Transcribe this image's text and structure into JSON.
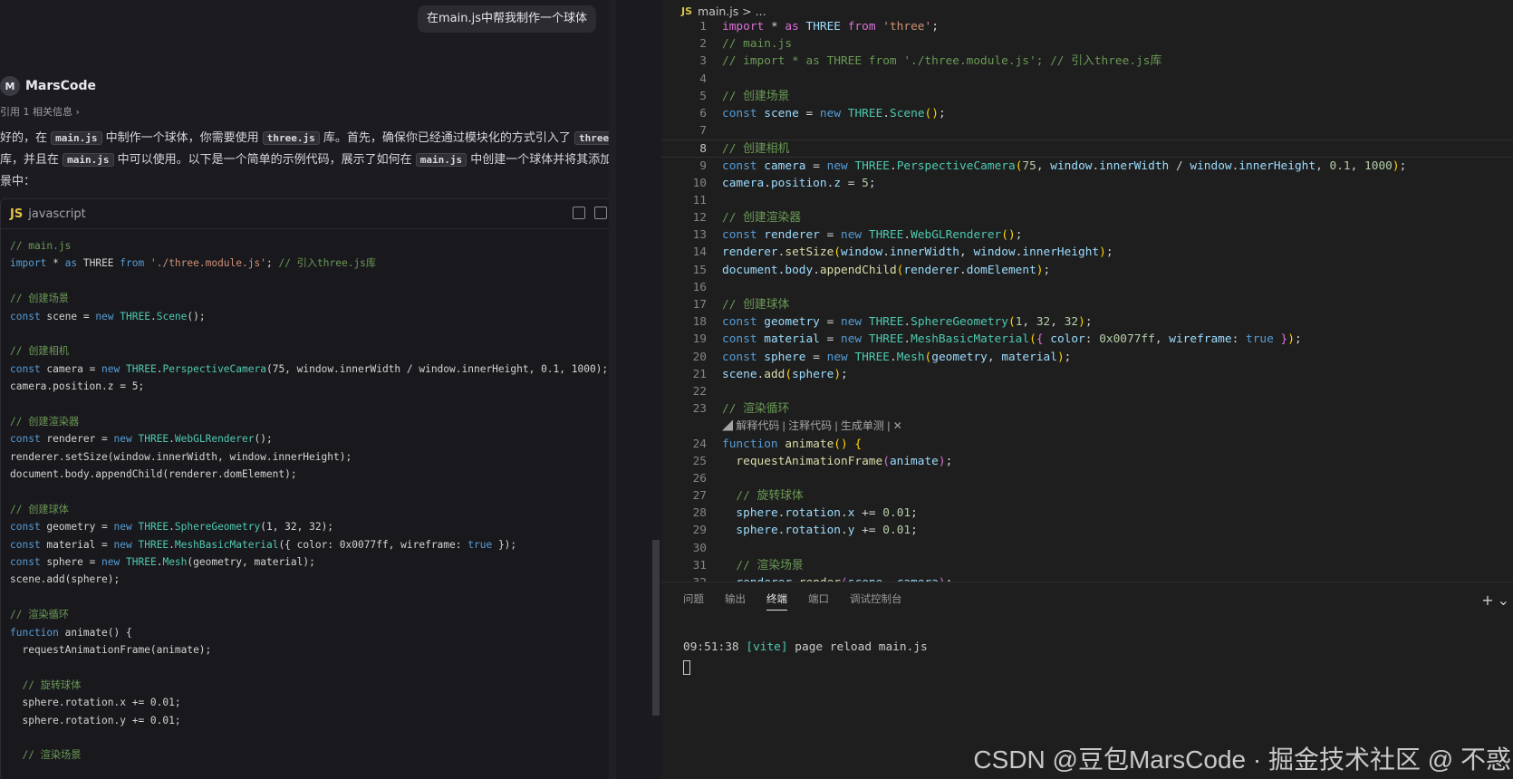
{
  "chat": {
    "user_message": "在main.js中帮我制作一个球体",
    "agent_name": "MarsCode",
    "agent_logo": "M",
    "reference_text": "引用 1 相关信息 ›",
    "intro": {
      "p1": "好的，在 ",
      "code1": "main.js",
      "p2": " 中制作一个球体，你需要使用 ",
      "code2": "three.js",
      "p3": " 库。首先，确保你已经通过模块化的方式引入了 ",
      "code3": "three.js",
      "p4": " 库，并且在 ",
      "code4": "main.js",
      "p5": " 中可以使用。以下是一个简单的示例代码，展示了如何在 ",
      "code5": "main.js",
      "p6": " 中创建一个球体并将其添加到场景中："
    },
    "code_lang_badge": "JS",
    "code_lang": "javascript",
    "code_lines": [
      [
        [
          "// main.js",
          "c"
        ]
      ],
      [
        [
          "import",
          "k"
        ],
        [
          " * ",
          "p"
        ],
        [
          "as",
          "k"
        ],
        [
          " THREE ",
          "p"
        ],
        [
          "from",
          "k"
        ],
        [
          " ",
          "p"
        ],
        [
          "'./three.module.js'",
          "s"
        ],
        [
          "; ",
          "p"
        ],
        [
          "// 引入three.js库",
          "c"
        ]
      ],
      [],
      [
        [
          "// 创建场景",
          "c"
        ]
      ],
      [
        [
          "const",
          "k"
        ],
        [
          " scene = ",
          "p"
        ],
        [
          "new",
          "k"
        ],
        [
          " ",
          "p"
        ],
        [
          "THREE",
          "t"
        ],
        [
          ".",
          "p"
        ],
        [
          "Scene",
          "t"
        ],
        [
          "();",
          "p"
        ]
      ],
      [],
      [
        [
          "// 创建相机",
          "c"
        ]
      ],
      [
        [
          "const",
          "k"
        ],
        [
          " camera = ",
          "p"
        ],
        [
          "new",
          "k"
        ],
        [
          " ",
          "p"
        ],
        [
          "THREE",
          "t"
        ],
        [
          ".",
          "p"
        ],
        [
          "PerspectiveCamera",
          "t"
        ],
        [
          "(75, window.innerWidth / window.innerHeight, 0.1, 1000);",
          "p"
        ]
      ],
      [
        [
          "camera.position.z = 5;",
          "p"
        ]
      ],
      [],
      [
        [
          "// 创建渲染器",
          "c"
        ]
      ],
      [
        [
          "const",
          "k"
        ],
        [
          " renderer = ",
          "p"
        ],
        [
          "new",
          "k"
        ],
        [
          " ",
          "p"
        ],
        [
          "THREE",
          "t"
        ],
        [
          ".",
          "p"
        ],
        [
          "WebGLRenderer",
          "t"
        ],
        [
          "();",
          "p"
        ]
      ],
      [
        [
          "renderer.setSize(window.innerWidth, window.innerHeight);",
          "p"
        ]
      ],
      [
        [
          "document.body.appendChild(renderer.domElement);",
          "p"
        ]
      ],
      [],
      [
        [
          "// 创建球体",
          "c"
        ]
      ],
      [
        [
          "const",
          "k"
        ],
        [
          " geometry = ",
          "p"
        ],
        [
          "new",
          "k"
        ],
        [
          " ",
          "p"
        ],
        [
          "THREE",
          "t"
        ],
        [
          ".",
          "p"
        ],
        [
          "SphereGeometry",
          "t"
        ],
        [
          "(1, 32, 32);",
          "p"
        ]
      ],
      [
        [
          "const",
          "k"
        ],
        [
          " material = ",
          "p"
        ],
        [
          "new",
          "k"
        ],
        [
          " ",
          "p"
        ],
        [
          "THREE",
          "t"
        ],
        [
          ".",
          "p"
        ],
        [
          "MeshBasicMaterial",
          "t"
        ],
        [
          "({ color: 0x0077ff, wireframe: ",
          "p"
        ],
        [
          "true",
          "k"
        ],
        [
          " });",
          "p"
        ]
      ],
      [
        [
          "const",
          "k"
        ],
        [
          " sphere = ",
          "p"
        ],
        [
          "new",
          "k"
        ],
        [
          " ",
          "p"
        ],
        [
          "THREE",
          "t"
        ],
        [
          ".",
          "p"
        ],
        [
          "Mesh",
          "t"
        ],
        [
          "(geometry, material);",
          "p"
        ]
      ],
      [
        [
          "scene.add(sphere);",
          "p"
        ]
      ],
      [],
      [
        [
          "// 渲染循环",
          "c"
        ]
      ],
      [
        [
          "function",
          "k"
        ],
        [
          " animate() {",
          "p"
        ]
      ],
      [
        [
          "  requestAnimationFrame(animate);",
          "p"
        ]
      ],
      [],
      [
        [
          "  // 旋转球体",
          "c"
        ]
      ],
      [
        [
          "  sphere.rotation.x += 0.01;",
          "p"
        ]
      ],
      [
        [
          "  sphere.rotation.y += 0.01;",
          "p"
        ]
      ],
      [],
      [
        [
          "  // 渲染场景",
          "c"
        ]
      ]
    ]
  },
  "editor": {
    "tab_badge": "JS",
    "breadcrumb": "main.js > ...",
    "hint_text": "解释代码 | 注释代码 | 生成单测 | ✕",
    "lines": [
      {
        "n": "1",
        "seg": [
          [
            "import",
            "m"
          ],
          [
            " * ",
            "p"
          ],
          [
            "as",
            "m"
          ],
          [
            " THREE ",
            "v"
          ],
          [
            "from",
            "m"
          ],
          [
            " ",
            "p"
          ],
          [
            "'three'",
            "s"
          ],
          [
            ";",
            "p"
          ]
        ]
      },
      {
        "n": "2",
        "seg": [
          [
            "// main.js",
            "c"
          ]
        ]
      },
      {
        "n": "3",
        "seg": [
          [
            "// import * as THREE from './three.module.js'; // 引入three.js库",
            "c"
          ]
        ]
      },
      {
        "n": "4",
        "seg": []
      },
      {
        "n": "5",
        "seg": [
          [
            "// 创建场景",
            "c"
          ]
        ]
      },
      {
        "n": "6",
        "seg": [
          [
            "const",
            "k"
          ],
          [
            " ",
            "p"
          ],
          [
            "scene",
            "v"
          ],
          [
            " = ",
            "p"
          ],
          [
            "new",
            "k"
          ],
          [
            " ",
            "p"
          ],
          [
            "THREE",
            "t"
          ],
          [
            ".",
            "p"
          ],
          [
            "Scene",
            "t"
          ],
          [
            "()",
            "y"
          ],
          [
            ";",
            "p"
          ]
        ]
      },
      {
        "n": "7",
        "seg": []
      },
      {
        "n": "8",
        "seg": [
          [
            "// 创建相机",
            "c"
          ]
        ]
      },
      {
        "n": "9",
        "seg": [
          [
            "const",
            "k"
          ],
          [
            " ",
            "p"
          ],
          [
            "camera",
            "v"
          ],
          [
            " = ",
            "p"
          ],
          [
            "new",
            "k"
          ],
          [
            " ",
            "p"
          ],
          [
            "THREE",
            "t"
          ],
          [
            ".",
            "p"
          ],
          [
            "PerspectiveCamera",
            "t"
          ],
          [
            "(",
            "y"
          ],
          [
            "75",
            "n"
          ],
          [
            ", ",
            "p"
          ],
          [
            "window",
            "v"
          ],
          [
            ".",
            "p"
          ],
          [
            "innerWidth",
            "v"
          ],
          [
            " / ",
            "p"
          ],
          [
            "window",
            "v"
          ],
          [
            ".",
            "p"
          ],
          [
            "innerHeight",
            "v"
          ],
          [
            ", ",
            "p"
          ],
          [
            "0.1",
            "n"
          ],
          [
            ", ",
            "p"
          ],
          [
            "1000",
            "n"
          ],
          [
            ")",
            "y"
          ],
          [
            ";",
            "p"
          ]
        ]
      },
      {
        "n": "10",
        "seg": [
          [
            "camera",
            "v"
          ],
          [
            ".",
            "p"
          ],
          [
            "position",
            "v"
          ],
          [
            ".",
            "p"
          ],
          [
            "z",
            "v"
          ],
          [
            " = ",
            "p"
          ],
          [
            "5",
            "n"
          ],
          [
            ";",
            "p"
          ]
        ]
      },
      {
        "n": "11",
        "seg": []
      },
      {
        "n": "12",
        "seg": [
          [
            "// 创建渲染器",
            "c"
          ]
        ]
      },
      {
        "n": "13",
        "seg": [
          [
            "const",
            "k"
          ],
          [
            " ",
            "p"
          ],
          [
            "renderer",
            "v"
          ],
          [
            " = ",
            "p"
          ],
          [
            "new",
            "k"
          ],
          [
            " ",
            "p"
          ],
          [
            "THREE",
            "t"
          ],
          [
            ".",
            "p"
          ],
          [
            "WebGLRenderer",
            "t"
          ],
          [
            "()",
            "y"
          ],
          [
            ";",
            "p"
          ]
        ]
      },
      {
        "n": "14",
        "seg": [
          [
            "renderer",
            "v"
          ],
          [
            ".",
            "p"
          ],
          [
            "setSize",
            "f"
          ],
          [
            "(",
            "y"
          ],
          [
            "window",
            "v"
          ],
          [
            ".",
            "p"
          ],
          [
            "innerWidth",
            "v"
          ],
          [
            ", ",
            "p"
          ],
          [
            "window",
            "v"
          ],
          [
            ".",
            "p"
          ],
          [
            "innerHeight",
            "v"
          ],
          [
            ")",
            "y"
          ],
          [
            ";",
            "p"
          ]
        ]
      },
      {
        "n": "15",
        "seg": [
          [
            "document",
            "v"
          ],
          [
            ".",
            "p"
          ],
          [
            "body",
            "v"
          ],
          [
            ".",
            "p"
          ],
          [
            "appendChild",
            "f"
          ],
          [
            "(",
            "y"
          ],
          [
            "renderer",
            "v"
          ],
          [
            ".",
            "p"
          ],
          [
            "domElement",
            "v"
          ],
          [
            ")",
            "y"
          ],
          [
            ";",
            "p"
          ]
        ]
      },
      {
        "n": "16",
        "seg": []
      },
      {
        "n": "17",
        "seg": [
          [
            "// 创建球体",
            "c"
          ]
        ]
      },
      {
        "n": "18",
        "seg": [
          [
            "const",
            "k"
          ],
          [
            " ",
            "p"
          ],
          [
            "geometry",
            "v"
          ],
          [
            " = ",
            "p"
          ],
          [
            "new",
            "k"
          ],
          [
            " ",
            "p"
          ],
          [
            "THREE",
            "t"
          ],
          [
            ".",
            "p"
          ],
          [
            "SphereGeometry",
            "t"
          ],
          [
            "(",
            "y"
          ],
          [
            "1",
            "n"
          ],
          [
            ", ",
            "p"
          ],
          [
            "32",
            "n"
          ],
          [
            ", ",
            "p"
          ],
          [
            "32",
            "n"
          ],
          [
            ")",
            "y"
          ],
          [
            ";",
            "p"
          ]
        ]
      },
      {
        "n": "19",
        "seg": [
          [
            "const",
            "k"
          ],
          [
            " ",
            "p"
          ],
          [
            "material",
            "v"
          ],
          [
            " = ",
            "p"
          ],
          [
            "new",
            "k"
          ],
          [
            " ",
            "p"
          ],
          [
            "THREE",
            "t"
          ],
          [
            ".",
            "p"
          ],
          [
            "MeshBasicMaterial",
            "t"
          ],
          [
            "(",
            "y"
          ],
          [
            "{ ",
            "m"
          ],
          [
            "color",
            "v"
          ],
          [
            ": ",
            "p"
          ],
          [
            "0x0077ff",
            "n"
          ],
          [
            ", ",
            "p"
          ],
          [
            "wireframe",
            "v"
          ],
          [
            ": ",
            "p"
          ],
          [
            "true",
            "k"
          ],
          [
            " }",
            "m"
          ],
          [
            ")",
            "y"
          ],
          [
            ";",
            "p"
          ]
        ]
      },
      {
        "n": "20",
        "seg": [
          [
            "const",
            "k"
          ],
          [
            " ",
            "p"
          ],
          [
            "sphere",
            "v"
          ],
          [
            " = ",
            "p"
          ],
          [
            "new",
            "k"
          ],
          [
            " ",
            "p"
          ],
          [
            "THREE",
            "t"
          ],
          [
            ".",
            "p"
          ],
          [
            "Mesh",
            "t"
          ],
          [
            "(",
            "y"
          ],
          [
            "geometry",
            "v"
          ],
          [
            ", ",
            "p"
          ],
          [
            "material",
            "v"
          ],
          [
            ")",
            "y"
          ],
          [
            ";",
            "p"
          ]
        ]
      },
      {
        "n": "21",
        "seg": [
          [
            "scene",
            "v"
          ],
          [
            ".",
            "p"
          ],
          [
            "add",
            "f"
          ],
          [
            "(",
            "y"
          ],
          [
            "sphere",
            "v"
          ],
          [
            ")",
            "y"
          ],
          [
            ";",
            "p"
          ]
        ]
      },
      {
        "n": "22",
        "seg": []
      },
      {
        "n": "23",
        "seg": [
          [
            "// 渲染循环",
            "c"
          ]
        ]
      },
      {
        "n": "",
        "hint": true
      },
      {
        "n": "24",
        "seg": [
          [
            "function",
            "k"
          ],
          [
            " ",
            "p"
          ],
          [
            "animate",
            "f"
          ],
          [
            "()",
            "y"
          ],
          [
            " {",
            "y"
          ]
        ]
      },
      {
        "n": "25",
        "seg": [
          [
            "  ",
            "p"
          ],
          [
            "requestAnimationFrame",
            "f"
          ],
          [
            "(",
            "m"
          ],
          [
            "animate",
            "v"
          ],
          [
            ")",
            "m"
          ],
          [
            ";",
            "p"
          ]
        ]
      },
      {
        "n": "26",
        "seg": []
      },
      {
        "n": "27",
        "seg": [
          [
            "  // 旋转球体",
            "c"
          ]
        ]
      },
      {
        "n": "28",
        "seg": [
          [
            "  ",
            "p"
          ],
          [
            "sphere",
            "v"
          ],
          [
            ".",
            "p"
          ],
          [
            "rotation",
            "v"
          ],
          [
            ".",
            "p"
          ],
          [
            "x",
            "v"
          ],
          [
            " += ",
            "p"
          ],
          [
            "0.01",
            "n"
          ],
          [
            ";",
            "p"
          ]
        ]
      },
      {
        "n": "29",
        "seg": [
          [
            "  ",
            "p"
          ],
          [
            "sphere",
            "v"
          ],
          [
            ".",
            "p"
          ],
          [
            "rotation",
            "v"
          ],
          [
            ".",
            "p"
          ],
          [
            "y",
            "v"
          ],
          [
            " += ",
            "p"
          ],
          [
            "0.01",
            "n"
          ],
          [
            ";",
            "p"
          ]
        ]
      },
      {
        "n": "30",
        "seg": []
      },
      {
        "n": "31",
        "seg": [
          [
            "  // 渲染场景",
            "c"
          ]
        ]
      },
      {
        "n": "32",
        "seg": [
          [
            "  ",
            "p"
          ],
          [
            "renderer",
            "v"
          ],
          [
            ".",
            "p"
          ],
          [
            "render",
            "f"
          ],
          [
            "(",
            "m"
          ],
          [
            "scene",
            "v"
          ],
          [
            ", ",
            "p"
          ],
          [
            "camera",
            "v"
          ],
          [
            ")",
            "m"
          ],
          [
            ";",
            "p"
          ]
        ]
      }
    ]
  },
  "panel": {
    "tabs": [
      "问题",
      "输出",
      "终端",
      "端口",
      "调试控制台"
    ],
    "active_tab": "终端",
    "add_icon": "+",
    "dropdown_icon": "⌄",
    "terminal_time": "09:51:38",
    "terminal_tag": "[vite]",
    "terminal_msg": " page reload main.js"
  },
  "watermark": "CSDN @豆包MarsCode · 掘金技术社区 @ 不惑"
}
